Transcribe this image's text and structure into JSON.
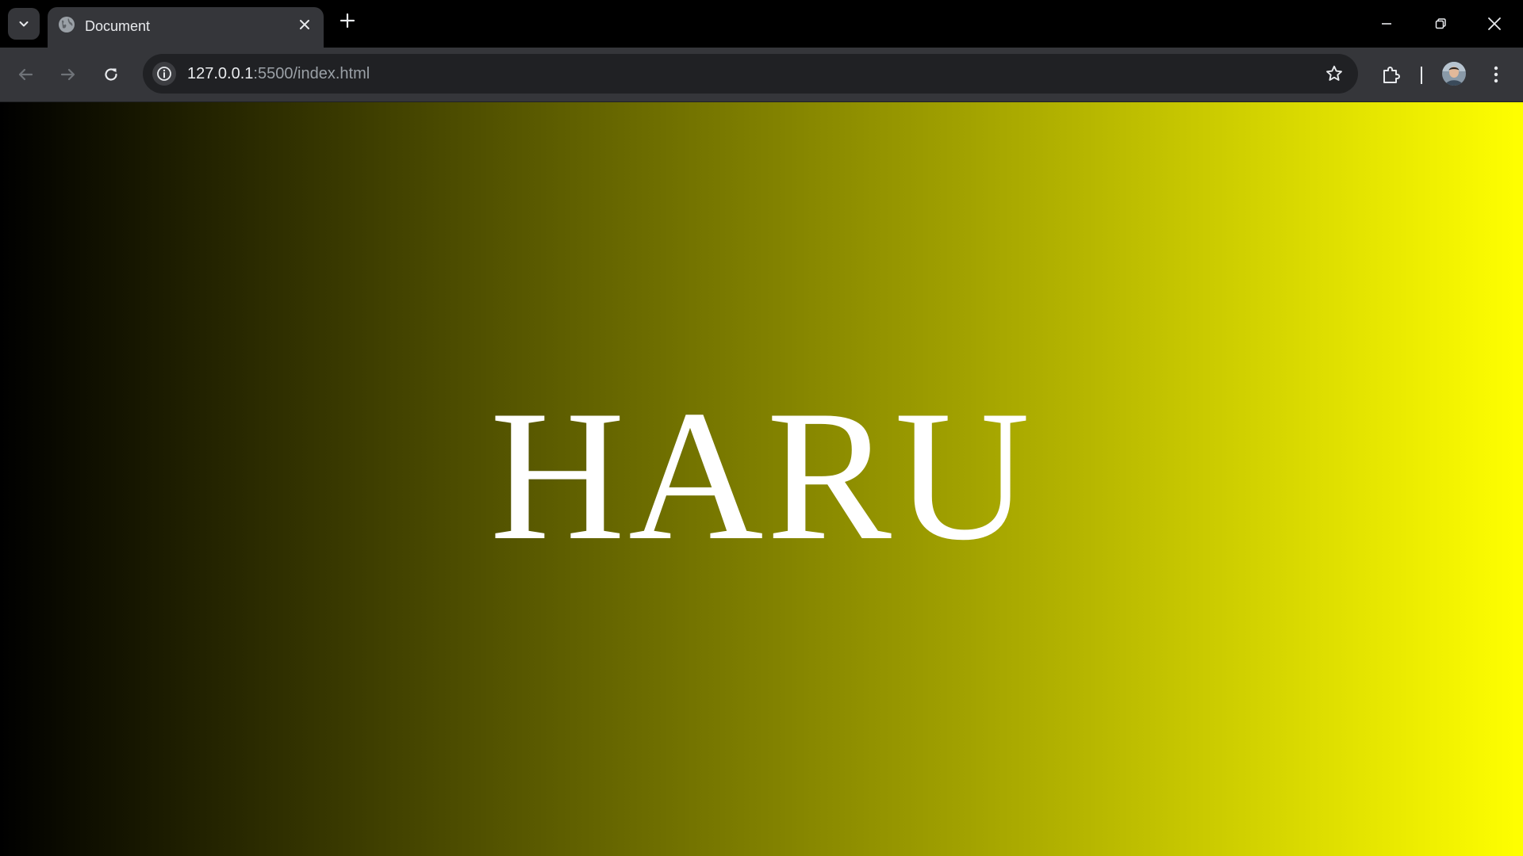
{
  "browser": {
    "tab": {
      "title": "Document",
      "favicon": "globe-icon"
    },
    "address_bar": {
      "host": "127.0.0.1",
      "path": ":5500/index.html"
    },
    "icons": {
      "tab_search": "chevron-down-icon",
      "close_tab": "close-icon",
      "new_tab": "plus-icon",
      "back": "arrow-left-icon",
      "forward": "arrow-right-icon",
      "reload": "reload-icon",
      "site_info": "info-icon",
      "bookmark": "star-icon",
      "extensions": "puzzle-icon",
      "profile": "avatar",
      "menu": "more-vertical-icon",
      "minimize": "minimize-icon",
      "restore": "restore-icon",
      "close_window": "close-icon"
    },
    "colors": {
      "frame": "#000000",
      "toolbar": "#35363a",
      "omnibox": "#202124"
    }
  },
  "page": {
    "heading": "HARU",
    "background_gradient": [
      "#000000",
      "#ffff00"
    ],
    "text_color": "#ffffff"
  }
}
